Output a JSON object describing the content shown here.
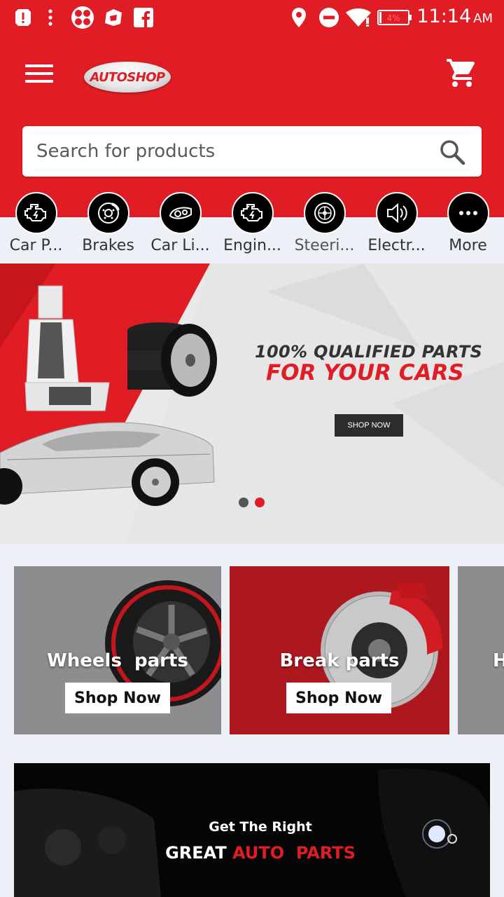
{
  "status_bar": {
    "time": "11:14",
    "ampm": "AM",
    "battery": "4%",
    "icons": [
      "alert-icon",
      "more-vert-icon",
      "clover-app-icon",
      "bag-app-icon",
      "facebook-icon",
      "location-icon",
      "do-not-disturb-icon",
      "wifi-icon",
      "battery-icon"
    ]
  },
  "header": {
    "logo_text": "AUTOSHOP",
    "menu_icon": "hamburger-menu-icon",
    "cart_icon": "shopping-cart-icon"
  },
  "search": {
    "placeholder": "Search for products",
    "icon": "search-icon"
  },
  "categories": [
    {
      "label": "Car P...",
      "icon": "engine-icon"
    },
    {
      "label": "Brakes",
      "icon": "brake-disc-icon"
    },
    {
      "label": "Car Li...",
      "icon": "headlight-icon"
    },
    {
      "label": "Engin...",
      "icon": "engine-icon"
    },
    {
      "label": "Steeri...",
      "icon": "wheel-icon"
    },
    {
      "label": "Electr...",
      "icon": "speaker-icon"
    },
    {
      "label": "More",
      "icon": "more-dots-icon"
    }
  ],
  "banner": {
    "headline_line1": "100% QUALIFIED PARTS",
    "headline_line2": "FOR YOUR CARS",
    "button_label": "SHOP NOW",
    "slide_count": 2,
    "active_slide": 2
  },
  "cards": [
    {
      "title": "Wheels  parts",
      "button": "Shop Now"
    },
    {
      "title": "Break parts",
      "button": "Shop Now"
    },
    {
      "title": "H",
      "button": ""
    }
  ],
  "promo": {
    "line1": "Get The Right",
    "line2_white": "GREAT",
    "line2_red": "AUTO  PARTS"
  },
  "colors": {
    "brand_red": "#e01d24",
    "background": "#eef0f8",
    "icon_circle": "#000000"
  }
}
